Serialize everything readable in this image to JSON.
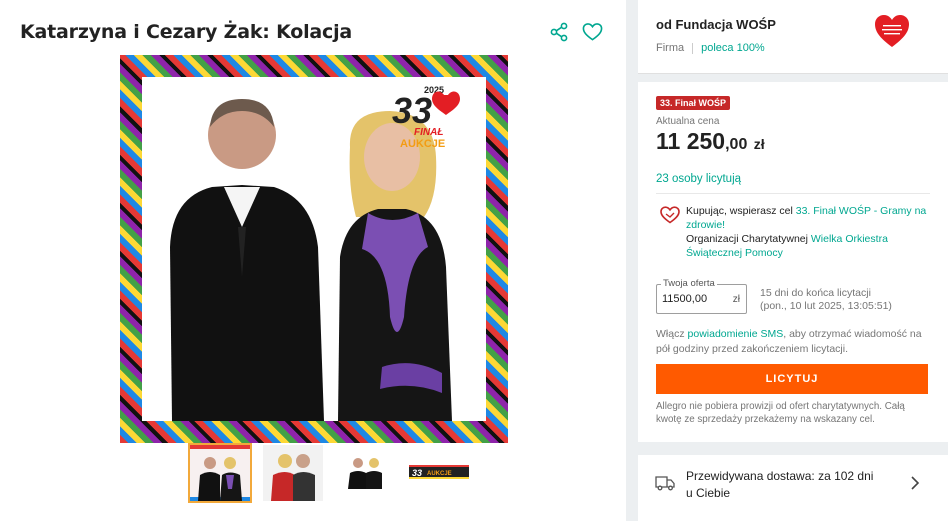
{
  "product": {
    "title": "Katarzyna i Cezary Żak: Kolacja",
    "badge": {
      "year": "2025",
      "number": "33",
      "line1": "FINAŁ",
      "line2": "AUKCJE"
    }
  },
  "seller": {
    "name": "od Fundacja WOŚP",
    "type": "Firma",
    "recommend": "poleca 100%"
  },
  "offer": {
    "final_badge": "33. Finał WOŚP",
    "price_label": "Aktualna cena",
    "price_int": "11 250",
    "price_dec": ",00",
    "price_cur": "zł",
    "bidders": "23 osoby licytują",
    "charity_prefix": "Kupując, wspierasz cel",
    "charity_cause": "33. Finał WOŚP - Gramy na zdrowie!",
    "charity_org_prefix": "Organizacji Charytatywnej",
    "charity_org": "Wielka Orkiestra Świątecznej Pomocy",
    "bid_legend": "Twoja oferta",
    "bid_value": "11500,00",
    "bid_currency": "zł",
    "time_left_line1": "15 dni do końca licytacji",
    "time_left_line2": "(pon., 10 lut 2025, 13:05:51)",
    "sms_prefix": "Włącz",
    "sms_link": "powiadomienie SMS",
    "sms_suffix": ", aby otrzymać wiadomość na pół godziny przed zakończeniem licytacji.",
    "bid_button": "LICYTUJ",
    "fee_note": "Allegro nie pobiera prowizji od ofert charytatywnych. Całą kwotę ze sprzedaży przekażemy na wskazany cel."
  },
  "delivery": {
    "line1": "Przewidywana dostawa: za 102 dni",
    "line2": "u Ciebie"
  },
  "colors": {
    "accent": "#00a790",
    "button": "#ff5a00",
    "badge": "#c62828",
    "wosp_red": "#e31e24"
  }
}
